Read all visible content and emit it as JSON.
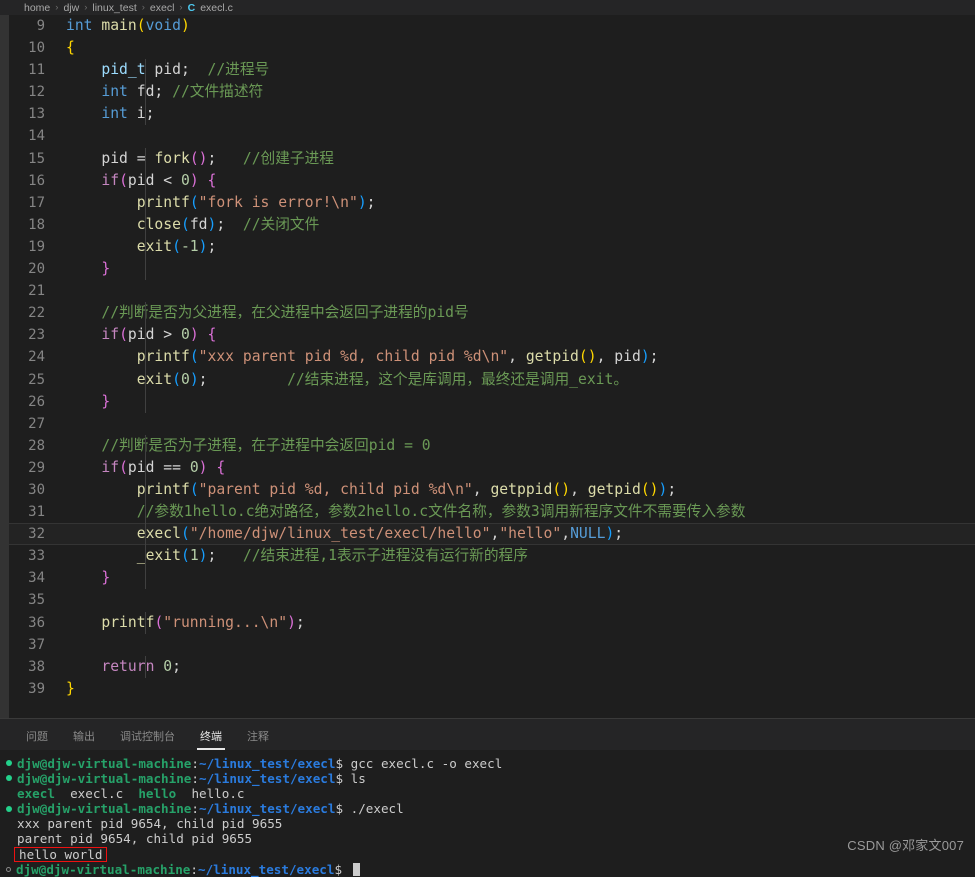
{
  "breadcrumb": {
    "segments": [
      "home",
      "djw",
      "linux_test",
      "execl"
    ],
    "separator": "›",
    "file_icon": "C",
    "file_name": "execl.c"
  },
  "editor": {
    "first_line_number": 9,
    "active_line": 32,
    "lines": [
      {
        "n": 9,
        "tokens": [
          {
            "t": "int",
            "c": "t-kw"
          },
          {
            "t": " ",
            "c": "t-pl"
          },
          {
            "t": "main",
            "c": "t-fn"
          },
          {
            "t": "(",
            "c": "t-br1"
          },
          {
            "t": "void",
            "c": "t-kw"
          },
          {
            "t": ")",
            "c": "t-br1"
          }
        ],
        "indent": 0
      },
      {
        "n": 10,
        "tokens": [
          {
            "t": "{",
            "c": "t-br1"
          }
        ],
        "indent": 0
      },
      {
        "n": 11,
        "tokens": [
          {
            "t": "    ",
            "c": "t-pl"
          },
          {
            "t": "pid_t",
            "c": "t-var"
          },
          {
            "t": " pid;  ",
            "c": "t-pl"
          },
          {
            "t": "//进程号",
            "c": "t-cmt"
          }
        ],
        "indent": 1
      },
      {
        "n": 12,
        "tokens": [
          {
            "t": "    ",
            "c": "t-pl"
          },
          {
            "t": "int",
            "c": "t-kw"
          },
          {
            "t": " fd; ",
            "c": "t-pl"
          },
          {
            "t": "//文件描述符",
            "c": "t-cmt"
          }
        ],
        "indent": 1
      },
      {
        "n": 13,
        "tokens": [
          {
            "t": "    ",
            "c": "t-pl"
          },
          {
            "t": "int",
            "c": "t-kw"
          },
          {
            "t": " i;",
            "c": "t-pl"
          }
        ],
        "indent": 1
      },
      {
        "n": 14,
        "tokens": [],
        "indent": 1
      },
      {
        "n": 15,
        "tokens": [
          {
            "t": "    pid = ",
            "c": "t-pl"
          },
          {
            "t": "fork",
            "c": "t-fn"
          },
          {
            "t": "(",
            "c": "t-br2"
          },
          {
            "t": ")",
            "c": "t-br2"
          },
          {
            "t": ";   ",
            "c": "t-pl"
          },
          {
            "t": "//创建子进程",
            "c": "t-cmt"
          }
        ],
        "indent": 1
      },
      {
        "n": 16,
        "tokens": [
          {
            "t": "    ",
            "c": "t-pl"
          },
          {
            "t": "if",
            "c": "t-ctl"
          },
          {
            "t": "(",
            "c": "t-br2"
          },
          {
            "t": "pid < ",
            "c": "t-pl"
          },
          {
            "t": "0",
            "c": "t-num"
          },
          {
            "t": ")",
            "c": "t-br2"
          },
          {
            "t": " ",
            "c": "t-pl"
          },
          {
            "t": "{",
            "c": "t-br2"
          }
        ],
        "indent": 1
      },
      {
        "n": 17,
        "tokens": [
          {
            "t": "        ",
            "c": "t-pl"
          },
          {
            "t": "printf",
            "c": "t-fn"
          },
          {
            "t": "(",
            "c": "t-br3"
          },
          {
            "t": "\"fork is error!\\n\"",
            "c": "t-str"
          },
          {
            "t": ")",
            "c": "t-br3"
          },
          {
            "t": ";",
            "c": "t-pl"
          }
        ],
        "indent": 2
      },
      {
        "n": 18,
        "tokens": [
          {
            "t": "        ",
            "c": "t-pl"
          },
          {
            "t": "close",
            "c": "t-fn"
          },
          {
            "t": "(",
            "c": "t-br3"
          },
          {
            "t": "fd",
            "c": "t-pl"
          },
          {
            "t": ")",
            "c": "t-br3"
          },
          {
            "t": ";  ",
            "c": "t-pl"
          },
          {
            "t": "//关闭文件",
            "c": "t-cmt"
          }
        ],
        "indent": 2
      },
      {
        "n": 19,
        "tokens": [
          {
            "t": "        ",
            "c": "t-pl"
          },
          {
            "t": "exit",
            "c": "t-fn"
          },
          {
            "t": "(",
            "c": "t-br3"
          },
          {
            "t": "-1",
            "c": "t-num"
          },
          {
            "t": ")",
            "c": "t-br3"
          },
          {
            "t": ";",
            "c": "t-pl"
          }
        ],
        "indent": 2
      },
      {
        "n": 20,
        "tokens": [
          {
            "t": "    ",
            "c": "t-pl"
          },
          {
            "t": "}",
            "c": "t-br2"
          }
        ],
        "indent": 1
      },
      {
        "n": 21,
        "tokens": [],
        "indent": 1
      },
      {
        "n": 22,
        "tokens": [
          {
            "t": "    ",
            "c": "t-pl"
          },
          {
            "t": "//判断是否为父进程，在父进程中会返回子进程的pid号",
            "c": "t-cmt"
          }
        ],
        "indent": 1
      },
      {
        "n": 23,
        "tokens": [
          {
            "t": "    ",
            "c": "t-pl"
          },
          {
            "t": "if",
            "c": "t-ctl"
          },
          {
            "t": "(",
            "c": "t-br2"
          },
          {
            "t": "pid > ",
            "c": "t-pl"
          },
          {
            "t": "0",
            "c": "t-num"
          },
          {
            "t": ")",
            "c": "t-br2"
          },
          {
            "t": " ",
            "c": "t-pl"
          },
          {
            "t": "{",
            "c": "t-br2"
          }
        ],
        "indent": 1
      },
      {
        "n": 24,
        "tokens": [
          {
            "t": "        ",
            "c": "t-pl"
          },
          {
            "t": "printf",
            "c": "t-fn"
          },
          {
            "t": "(",
            "c": "t-br3"
          },
          {
            "t": "\"xxx parent pid %d, child pid %d\\n\"",
            "c": "t-str"
          },
          {
            "t": ", ",
            "c": "t-pl"
          },
          {
            "t": "getpid",
            "c": "t-fn"
          },
          {
            "t": "(",
            "c": "t-br1"
          },
          {
            "t": ")",
            "c": "t-br1"
          },
          {
            "t": ", pid",
            "c": "t-pl"
          },
          {
            "t": ")",
            "c": "t-br3"
          },
          {
            "t": ";",
            "c": "t-pl"
          }
        ],
        "indent": 2
      },
      {
        "n": 25,
        "tokens": [
          {
            "t": "        ",
            "c": "t-pl"
          },
          {
            "t": "exit",
            "c": "t-fn"
          },
          {
            "t": "(",
            "c": "t-br3"
          },
          {
            "t": "0",
            "c": "t-num"
          },
          {
            "t": ")",
            "c": "t-br3"
          },
          {
            "t": ";         ",
            "c": "t-pl"
          },
          {
            "t": "//结束进程，这个是库调用，最终还是调用_exit。",
            "c": "t-cmt"
          }
        ],
        "indent": 2
      },
      {
        "n": 26,
        "tokens": [
          {
            "t": "    ",
            "c": "t-pl"
          },
          {
            "t": "}",
            "c": "t-br2"
          }
        ],
        "indent": 1
      },
      {
        "n": 27,
        "tokens": [],
        "indent": 1
      },
      {
        "n": 28,
        "tokens": [
          {
            "t": "    ",
            "c": "t-pl"
          },
          {
            "t": "//判断是否为子进程，在子进程中会返回pid = 0",
            "c": "t-cmt"
          }
        ],
        "indent": 1
      },
      {
        "n": 29,
        "tokens": [
          {
            "t": "    ",
            "c": "t-pl"
          },
          {
            "t": "if",
            "c": "t-ctl"
          },
          {
            "t": "(",
            "c": "t-br2"
          },
          {
            "t": "pid == ",
            "c": "t-pl"
          },
          {
            "t": "0",
            "c": "t-num"
          },
          {
            "t": ")",
            "c": "t-br2"
          },
          {
            "t": " ",
            "c": "t-pl"
          },
          {
            "t": "{",
            "c": "t-br2"
          }
        ],
        "indent": 1
      },
      {
        "n": 30,
        "tokens": [
          {
            "t": "        ",
            "c": "t-pl"
          },
          {
            "t": "printf",
            "c": "t-fn"
          },
          {
            "t": "(",
            "c": "t-br3"
          },
          {
            "t": "\"parent pid %d, child pid %d\\n\"",
            "c": "t-str"
          },
          {
            "t": ", ",
            "c": "t-pl"
          },
          {
            "t": "getppid",
            "c": "t-fn"
          },
          {
            "t": "(",
            "c": "t-br1"
          },
          {
            "t": ")",
            "c": "t-br1"
          },
          {
            "t": ", ",
            "c": "t-pl"
          },
          {
            "t": "getpid",
            "c": "t-fn"
          },
          {
            "t": "(",
            "c": "t-br1"
          },
          {
            "t": ")",
            "c": "t-br1"
          },
          {
            "t": ")",
            "c": "t-br3"
          },
          {
            "t": ";",
            "c": "t-pl"
          }
        ],
        "indent": 2
      },
      {
        "n": 31,
        "tokens": [
          {
            "t": "        ",
            "c": "t-pl"
          },
          {
            "t": "//参数1hello.c绝对路径，参数2hello.c文件名称，参数3调用新程序文件不需要传入参数",
            "c": "t-cmt"
          }
        ],
        "indent": 2
      },
      {
        "n": 32,
        "tokens": [
          {
            "t": "        ",
            "c": "t-pl"
          },
          {
            "t": "execl",
            "c": "t-fn"
          },
          {
            "t": "(",
            "c": "t-br3"
          },
          {
            "t": "\"/home/djw/linux_test/execl/hello\"",
            "c": "t-str"
          },
          {
            "t": ",",
            "c": "t-pl"
          },
          {
            "t": "\"hello\"",
            "c": "t-str"
          },
          {
            "t": ",",
            "c": "t-pl"
          },
          {
            "t": "NULL",
            "c": "t-const"
          },
          {
            "t": ")",
            "c": "t-br3"
          },
          {
            "t": ";",
            "c": "t-pl"
          }
        ],
        "indent": 2
      },
      {
        "n": 33,
        "tokens": [
          {
            "t": "        ",
            "c": "t-pl"
          },
          {
            "t": "_exit",
            "c": "t-fn"
          },
          {
            "t": "(",
            "c": "t-br3"
          },
          {
            "t": "1",
            "c": "t-num"
          },
          {
            "t": ")",
            "c": "t-br3"
          },
          {
            "t": ";   ",
            "c": "t-pl"
          },
          {
            "t": "//结束进程,1表示子进程没有运行新的程序",
            "c": "t-cmt"
          }
        ],
        "indent": 2
      },
      {
        "n": 34,
        "tokens": [
          {
            "t": "    ",
            "c": "t-pl"
          },
          {
            "t": "}",
            "c": "t-br2"
          }
        ],
        "indent": 1
      },
      {
        "n": 35,
        "tokens": [],
        "indent": 1
      },
      {
        "n": 36,
        "tokens": [
          {
            "t": "    ",
            "c": "t-pl"
          },
          {
            "t": "printf",
            "c": "t-fn"
          },
          {
            "t": "(",
            "c": "t-br2"
          },
          {
            "t": "\"running...\\n\"",
            "c": "t-str"
          },
          {
            "t": ")",
            "c": "t-br2"
          },
          {
            "t": ";",
            "c": "t-pl"
          }
        ],
        "indent": 1
      },
      {
        "n": 37,
        "tokens": [],
        "indent": 1
      },
      {
        "n": 38,
        "tokens": [
          {
            "t": "    ",
            "c": "t-pl"
          },
          {
            "t": "return",
            "c": "t-ctl"
          },
          {
            "t": " ",
            "c": "t-pl"
          },
          {
            "t": "0",
            "c": "t-num"
          },
          {
            "t": ";",
            "c": "t-pl"
          }
        ],
        "indent": 1
      },
      {
        "n": 39,
        "tokens": [
          {
            "t": "}",
            "c": "t-br1"
          }
        ],
        "indent": 0
      }
    ]
  },
  "panel": {
    "tabs": [
      {
        "label": "问题",
        "active": false
      },
      {
        "label": "输出",
        "active": false
      },
      {
        "label": "调试控制台",
        "active": false
      },
      {
        "label": "终端",
        "active": true
      },
      {
        "label": "注释",
        "active": false
      }
    ]
  },
  "terminal": {
    "prompt_user": "djw@djw-virtual-machine",
    "prompt_path": "~/linux_test/execl",
    "lines": [
      {
        "type": "prompt",
        "marker": "filled",
        "command": "gcc execl.c -o execl"
      },
      {
        "type": "prompt",
        "marker": "filled",
        "command": "ls"
      },
      {
        "type": "ls",
        "marker": "none",
        "items": [
          {
            "text": "execl",
            "exe": true
          },
          {
            "text": "execl.c",
            "exe": false
          },
          {
            "text": "hello",
            "exe": true
          },
          {
            "text": "hello.c",
            "exe": false
          }
        ]
      },
      {
        "type": "prompt",
        "marker": "filled",
        "command": "./execl"
      },
      {
        "type": "output",
        "marker": "none",
        "text": "xxx parent pid 9654, child pid 9655"
      },
      {
        "type": "output",
        "marker": "none",
        "text": "parent pid 9654, child pid 9655"
      },
      {
        "type": "output",
        "marker": "none",
        "text": "hello world",
        "boxed": true
      },
      {
        "type": "prompt",
        "marker": "hollow",
        "command": "",
        "cursor": true
      }
    ]
  },
  "watermark": "CSDN @邓家文007",
  "colors": {
    "editor_bg": "#1e1e1e",
    "panel_bg": "#252526",
    "left_strip": "#333333",
    "accent_blue": "#4ec9f0",
    "annotation_red": "#ee1111",
    "terminal_green": "#26a269",
    "terminal_path_blue": "#2a7bde"
  }
}
